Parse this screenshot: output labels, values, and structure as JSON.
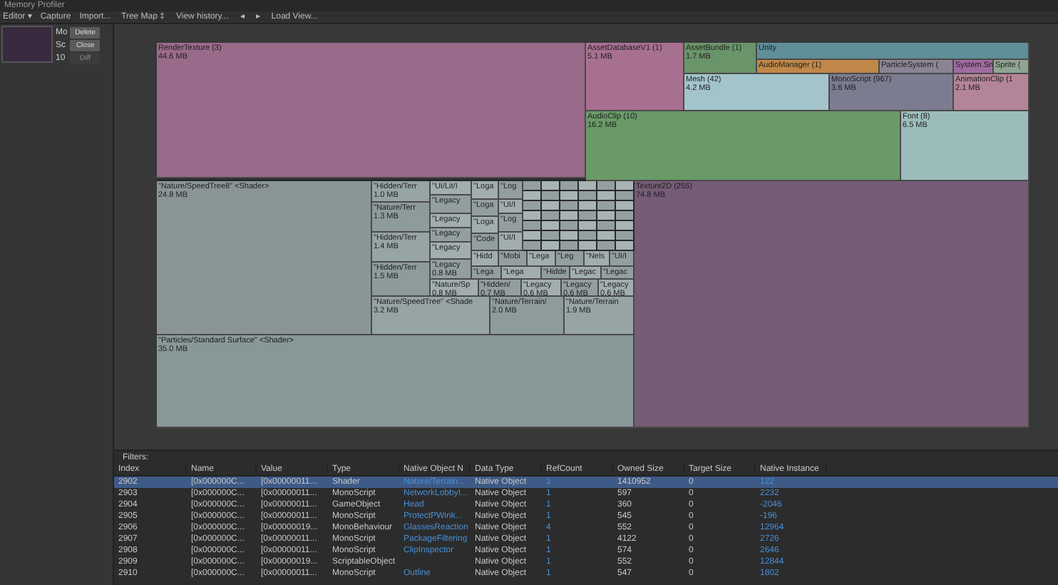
{
  "window": {
    "title": "Memory Profiler"
  },
  "toolbar_left": [
    "Editor ▾",
    "Capture",
    "Import..."
  ],
  "toolbar_right": [
    "Tree Map ‡",
    "View history...",
    "◂",
    "▸",
    "Load View..."
  ],
  "snapshot": {
    "labels": [
      "Mo",
      "Sc",
      "10"
    ],
    "buttons": [
      {
        "label": "Delete",
        "disabled": false
      },
      {
        "label": "Close",
        "disabled": false
      },
      {
        "label": "Diff",
        "disabled": true
      }
    ]
  },
  "treemap": {
    "cells": [
      {
        "label": "RenderTexture (3)",
        "size": "44.6 MB",
        "color": "#9a6a8a"
      },
      {
        "label": "AssetDatabaseV1 (1)",
        "size": "5.1 MB",
        "color": "#a87090"
      },
      {
        "label": "AssetBundle (1)",
        "size": "1.7 MB",
        "color": "#6a946a"
      },
      {
        "label": "Unity",
        "color": "#5f8f98"
      },
      {
        "label": "AudioManager (1)",
        "color": "#c08848"
      },
      {
        "label": "ParticleSystem (",
        "color": "#8a8494"
      },
      {
        "label": "System.Sn",
        "color": "#a06ca0"
      },
      {
        "label": "Sprite (",
        "color": "#90a494"
      },
      {
        "label": "Mesh (42)",
        "size": "4.2 MB",
        "color": "#a4c4cc"
      },
      {
        "label": "MonoScript (967)",
        "size": "3.6 MB",
        "color": "#7c7c90"
      },
      {
        "label": "AnimationClip (1",
        "size": "2.1 MB",
        "color": "#b48498"
      },
      {
        "label": "AudioClip (10)",
        "size": "16.2 MB",
        "color": "#6a9a68"
      },
      {
        "label": "Font (8)",
        "size": "6.5 MB",
        "color": "#9cbcbc"
      },
      {
        "label": "\"Nature/SpeedTree8\" <Shader>",
        "size": "24.8 MB",
        "color": "#8a9696"
      },
      {
        "label": "\"Particles/Standard Surface\" <Shader>",
        "size": "35.0 MB",
        "color": "#889898"
      },
      {
        "label": "\"Hidden/Terr",
        "size": "1.0 MB",
        "color": "#97a4a4"
      },
      {
        "label": "\"Nature/Terr",
        "size": "1.3 MB",
        "color": "#8e9b9b"
      },
      {
        "label": "\"Hidden/Terr",
        "size": "1.4 MB",
        "color": "#97a4a4"
      },
      {
        "label": "\"Hidden/Terr",
        "size": "1.5 MB",
        "color": "#8e9b9b"
      },
      {
        "label": "\"Nature/SpeedTree\" <Shade",
        "size": "3.2 MB",
        "color": "#97a4a4"
      },
      {
        "label": "\"Nature/Terrain/",
        "size": "2.0 MB",
        "color": "#8e9b9b"
      },
      {
        "label": "\"Nature/Terrain",
        "size": "1.9 MB",
        "color": "#97a4a4"
      },
      {
        "label": "\"UI/Lit/I",
        "color": "#a2aeae"
      },
      {
        "label": "\"Legacy",
        "color": "#939f9f"
      },
      {
        "label": "\"Legacy",
        "color": "#a2aeae"
      },
      {
        "label": "\"Legacy",
        "color": "#939f9f"
      },
      {
        "label": "\"Legacy",
        "color": "#a2aeae"
      },
      {
        "label": "\"Legacy",
        "size": "0.8 MB",
        "color": "#939f9f"
      },
      {
        "label": "\"Loga",
        "color": "#a2aeae"
      },
      {
        "label": "\"Loga",
        "color": "#939f9f"
      },
      {
        "label": "\"Loga",
        "color": "#a2aeae"
      },
      {
        "label": "\"Code",
        "color": "#939f9f"
      },
      {
        "label": "\"Log",
        "color": "#939f9f"
      },
      {
        "label": "\"UI/I",
        "color": "#a2aeae"
      },
      {
        "label": "\"Log",
        "color": "#939f9f"
      },
      {
        "label": "\"UI/I",
        "color": "#a2aeae"
      },
      {
        "label": "\"Hidd",
        "color": "#a2aeae"
      },
      {
        "label": "\"Mobi",
        "color": "#939f9f"
      },
      {
        "label": "\"Lega",
        "color": "#a2aeae"
      },
      {
        "label": "\"Leg",
        "color": "#939f9f"
      },
      {
        "label": "\"Nels",
        "color": "#a2aeae"
      },
      {
        "label": "\"UI/I",
        "color": "#939f9f"
      },
      {
        "label": "\"Lega",
        "color": "#939f9f"
      },
      {
        "label": "\"Lega",
        "color": "#a2aeae"
      },
      {
        "label": "\"Hidde",
        "color": "#939f9f"
      },
      {
        "label": "\"Legac",
        "color": "#a2aeae"
      },
      {
        "label": "\"Legac",
        "color": "#939f9f"
      },
      {
        "label": "\"Nature/Sp",
        "size": "0.8 MB",
        "color": "#a2aeae"
      },
      {
        "label": "\"Hidden/",
        "size": "0.7 MB",
        "color": "#939f9f"
      },
      {
        "label": "\"Legacy",
        "size": "0.6 MB",
        "color": "#a2aeae"
      },
      {
        "label": "\"Legacy",
        "size": "0.6 MB",
        "color": "#939f9f"
      },
      {
        "label": "\"Legacy",
        "size": "0.6 MB",
        "color": "#a2aeae"
      },
      {
        "label": "Texture2D (255)",
        "size": "74.8 MB",
        "color": "#765c76"
      }
    ]
  },
  "filters_label": "Filters:",
  "table": {
    "columns": [
      "Index",
      "Name",
      "Value",
      "Type",
      "Native Object N",
      "Data Type",
      "RefCount",
      "Owned Size",
      "Target Size",
      "Native Instance"
    ],
    "rows": [
      {
        "selected": true,
        "cells": [
          "2902",
          "[0x000000C...",
          "[0x00000011...",
          "Shader",
          "Nature/Terrain...",
          "Native Object",
          "1",
          "1410952",
          "0",
          "122"
        ]
      },
      {
        "selected": false,
        "cells": [
          "2903",
          "[0x000000C...",
          "[0x00000011...",
          "MonoScript",
          "NetworkLobbyI...",
          "Native Object",
          "1",
          "597",
          "0",
          "2232"
        ]
      },
      {
        "selected": false,
        "cells": [
          "2904",
          "[0x000000C...",
          "[0x00000011...",
          "GameObject",
          "Head",
          "Native Object",
          "1",
          "360",
          "0",
          "-2046"
        ]
      },
      {
        "selected": false,
        "cells": [
          "2905",
          "[0x000000C...",
          "[0x00000011...",
          "MonoScript",
          "ProtectPWink...",
          "Native Object",
          "1",
          "545",
          "0",
          "-196"
        ]
      },
      {
        "selected": false,
        "cells": [
          "2906",
          "[0x000000C...",
          "[0x00000019...",
          "MonoBehaviour",
          "GlassesReaction",
          "Native Object",
          "4",
          "552",
          "0",
          "12964"
        ]
      },
      {
        "selected": false,
        "cells": [
          "2907",
          "[0x000000C...",
          "[0x00000011...",
          "MonoScript",
          "PackageFiltering",
          "Native Object",
          "1",
          "4122",
          "0",
          "2726"
        ]
      },
      {
        "selected": false,
        "cells": [
          "2908",
          "[0x000000C...",
          "[0x00000011...",
          "MonoScript",
          "ClipInspector",
          "Native Object",
          "1",
          "574",
          "0",
          "2646"
        ]
      },
      {
        "selected": false,
        "cells": [
          "2909",
          "[0x000000C...",
          "[0x00000019...",
          "ScriptableObject",
          "",
          "Native Object",
          "1",
          "552",
          "0",
          "12844"
        ]
      },
      {
        "selected": false,
        "cells": [
          "2910",
          "[0x000000C...",
          "[0x00000011...",
          "MonoScript",
          "Outline",
          "Native Object",
          "1",
          "547",
          "0",
          "1802"
        ]
      }
    ]
  }
}
